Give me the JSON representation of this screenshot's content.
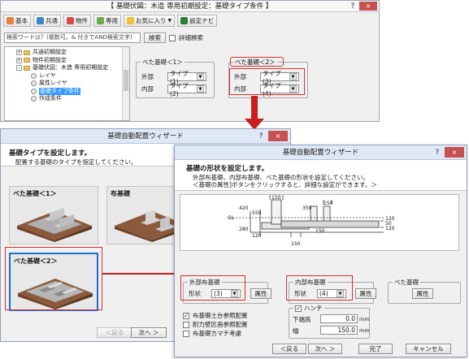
{
  "win1": {
    "title": "【 基礎伏図：木造 専用初期設定：基礎タイプ条件 】",
    "help": "?",
    "close": "×",
    "toolbar": [
      {
        "label": "基本",
        "icon": "house-icon",
        "color": "#e9813b"
      },
      {
        "label": "共通",
        "icon": "share-icon",
        "color": "#3d85c6"
      },
      {
        "label": "物件",
        "icon": "building-icon",
        "color": "#d64a4a"
      },
      {
        "label": "専用",
        "icon": "tool-icon",
        "color": "#6aa84f"
      },
      {
        "label": "お気に入り",
        "icon": "star-icon",
        "color": "#f1c232"
      },
      {
        "label": "設定ナビ",
        "icon": "navi-icon",
        "color": "#2e7d32"
      }
    ],
    "search_placeholder": "検索ワードは？(複数可。& 付きでAND検索文字)",
    "search_button": "検索",
    "detail_search": "詳細検索",
    "tree": [
      {
        "label": "共通初期設定",
        "type": "folder",
        "expand": "+"
      },
      {
        "label": "物件初期設定",
        "type": "folder",
        "expand": "+"
      },
      {
        "label": "基礎伏図：木造 専用初期設定",
        "type": "folder",
        "expand": "-"
      },
      {
        "label": "レイヤ",
        "type": "leaf"
      },
      {
        "label": "属性レイヤ",
        "type": "leaf"
      },
      {
        "label": "基礎タイプ条件",
        "type": "leaf",
        "selected": true
      },
      {
        "label": "作成条件",
        "type": "leaf"
      }
    ],
    "group1": {
      "title": "べた基礎＜1＞",
      "outer_label": "外部",
      "outer_value": "タイプ(1)",
      "inner_label": "内部",
      "inner_value": "タイプ(2)"
    },
    "group2": {
      "title": "べた基礎＜2＞",
      "outer_label": "外部",
      "outer_value": "タイプ(3)",
      "inner_label": "内部",
      "inner_value": "タイプ(4)"
    }
  },
  "win2": {
    "title": "基礎自動配置ウィザード",
    "help": "?",
    "close": "×",
    "heading": "基礎タイプを設定します。",
    "sub": "配置する基礎のタイプを指定してください。",
    "tiles": [
      "べた基礎＜1＞",
      "布基礎",
      "べた基礎＜2＞"
    ],
    "back": "＜戻る",
    "next": "次へ ＞"
  },
  "win3": {
    "title": "基礎自動配置ウィザード",
    "help": "?",
    "close": "×",
    "heading": "基礎の形状を設定します。",
    "sub1": "外部布基礎、内部布基礎、べた基礎の形状を設定してください。",
    "sub2": "＜基礎の属性]ボタンをクリックすると、詳細な設定ができます。＞",
    "dims": {
      "top_150a": "150",
      "top_150b": "150",
      "d420": "420",
      "d550": "550",
      "d350": "350",
      "d280": "280",
      "d120a": "120",
      "d150_mid": "150",
      "d150_bot": "150",
      "d120b": "120",
      "d50": "50",
      "d120c": "120",
      "gl": "GL"
    },
    "outer": {
      "title": "外部布基礎",
      "shape_label": "形状",
      "shape_value": "(3)",
      "attr": "属性"
    },
    "inner": {
      "title": "内部布基礎",
      "shape_label": "形状",
      "shape_value": "(4)",
      "attr": "属性"
    },
    "beta": {
      "title": "べた基礎",
      "attr": "属性"
    },
    "checks": [
      {
        "label": "布基礎土台参照配置",
        "checked": true
      },
      {
        "label": "耐力壁区画参照配置",
        "checked": false
      },
      {
        "label": "布基礎カマチ考慮",
        "checked": false
      }
    ],
    "haunch": {
      "label": "ハンチ",
      "checked": true,
      "height_label": "下端高",
      "height_value": "0.0",
      "width_label": "幅",
      "width_value": "150.0",
      "unit": "mm"
    },
    "back": "＜戻る",
    "next": "次へ ＞",
    "finish": "完了",
    "cancel": "キャンセル"
  }
}
